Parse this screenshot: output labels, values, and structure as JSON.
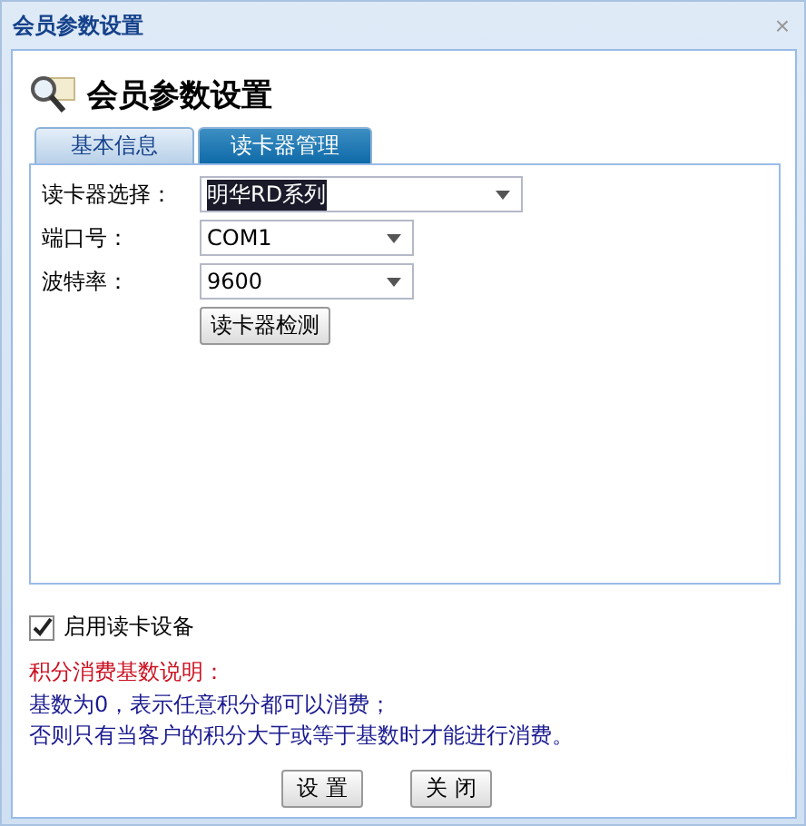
{
  "window": {
    "title": "会员参数设置",
    "close": "×"
  },
  "header": {
    "title": "会员参数设置"
  },
  "tabs": [
    {
      "label": "基本信息",
      "selected": false
    },
    {
      "label": "读卡器管理",
      "selected": true
    }
  ],
  "fields": [
    {
      "label": "读卡器选择：",
      "value": "明华RD系列",
      "highlighted": true,
      "wide": true
    },
    {
      "label": "端口号：",
      "value": "COM1",
      "highlighted": false,
      "wide": false
    },
    {
      "label": "波特率：",
      "value": "9600",
      "highlighted": false,
      "wide": false
    }
  ],
  "detect_button": "读卡器检测",
  "enable_reader": {
    "label": "启用读卡设备",
    "checked": true
  },
  "note": {
    "title": "积分消费基数说明：",
    "lines": [
      "基数为0，表示任意积分都可以消费；",
      "否则只有当客户的积分大于或等于基数时才能进行消费。"
    ]
  },
  "buttons": [
    "设 置",
    "关 闭"
  ]
}
